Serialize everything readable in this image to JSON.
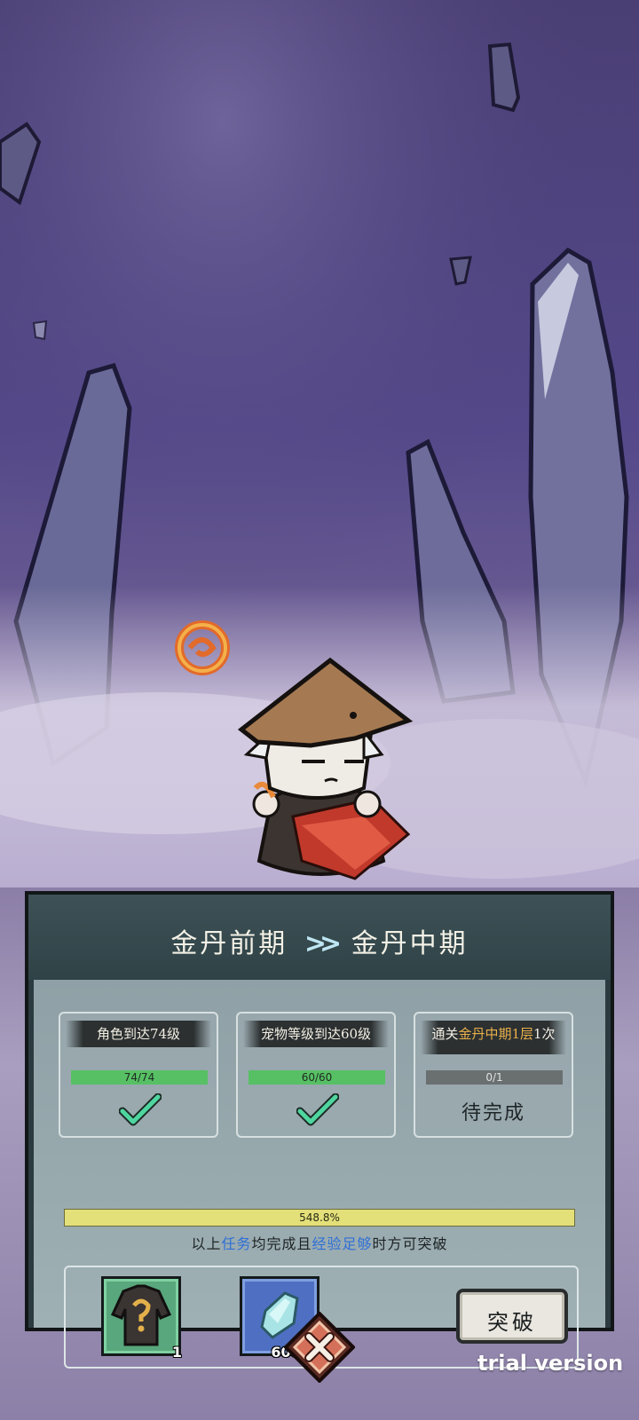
{
  "breakthrough": {
    "from_realm": "金丹前期",
    "arrows": ">>",
    "to_realm": "金丹中期"
  },
  "tasks": [
    {
      "label": "角色到达74级",
      "progress_text": "74/74",
      "progress_fraction": 1.0,
      "status": "complete"
    },
    {
      "label": "宠物等级到达60级",
      "progress_text": "60/60",
      "progress_fraction": 1.0,
      "status": "complete"
    },
    {
      "label_prefix": "通关",
      "label_highlight": "金丹中期1层",
      "label_suffix": "1次",
      "progress_text": "0/1",
      "progress_fraction": 0.0,
      "status_text": "待完成"
    }
  ],
  "experience": {
    "percent_text": "548.8%",
    "percent_value": 548.8
  },
  "hint": {
    "part1": "以上",
    "part2": "任务",
    "part3": "均完成且",
    "part4": "经验足够",
    "part5": "时方可突破"
  },
  "rewards": [
    {
      "icon": "mystery-robe-icon",
      "count": "1"
    },
    {
      "icon": "spirit-crystal-icon",
      "count": "60000"
    }
  ],
  "break_button": "突破",
  "watermark": "trial version",
  "colors": {
    "progress_green": "#57c064",
    "highlight_gold": "#e8b04b",
    "hint_blue": "#2f6fd6",
    "exp_yellow": "#e3e07a"
  }
}
